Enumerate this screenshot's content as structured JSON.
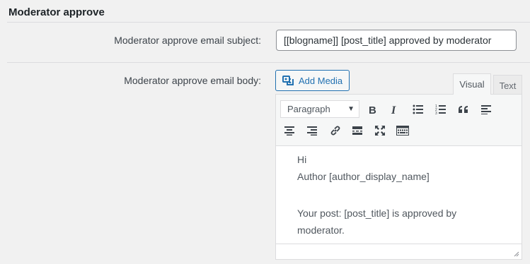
{
  "section": {
    "title": "Moderator approve"
  },
  "subject": {
    "label": "Moderator approve email subject:",
    "value": "[[blogname]] [post_title] approved by moderator"
  },
  "body": {
    "label": "Moderator approve email body:",
    "add_media_label": "Add Media",
    "tabs": {
      "visual": "Visual",
      "text": "Text"
    },
    "format_select": "Paragraph",
    "content": {
      "line1": "Hi",
      "line2": "Author [author_display_name]",
      "line3": "Your post: [post_title] is approved by",
      "line4": "moderator."
    }
  },
  "toolbar_icons": [
    "bold-icon",
    "italic-icon",
    "bullet-list-icon",
    "numbered-list-icon",
    "blockquote-icon",
    "align-left-icon",
    "align-center-icon",
    "align-right-icon",
    "link-icon",
    "read-more-icon",
    "fullscreen-icon",
    "toolbar-toggle-icon"
  ],
  "colors": {
    "accent": "#2271b1",
    "background": "#f1f1f1"
  }
}
